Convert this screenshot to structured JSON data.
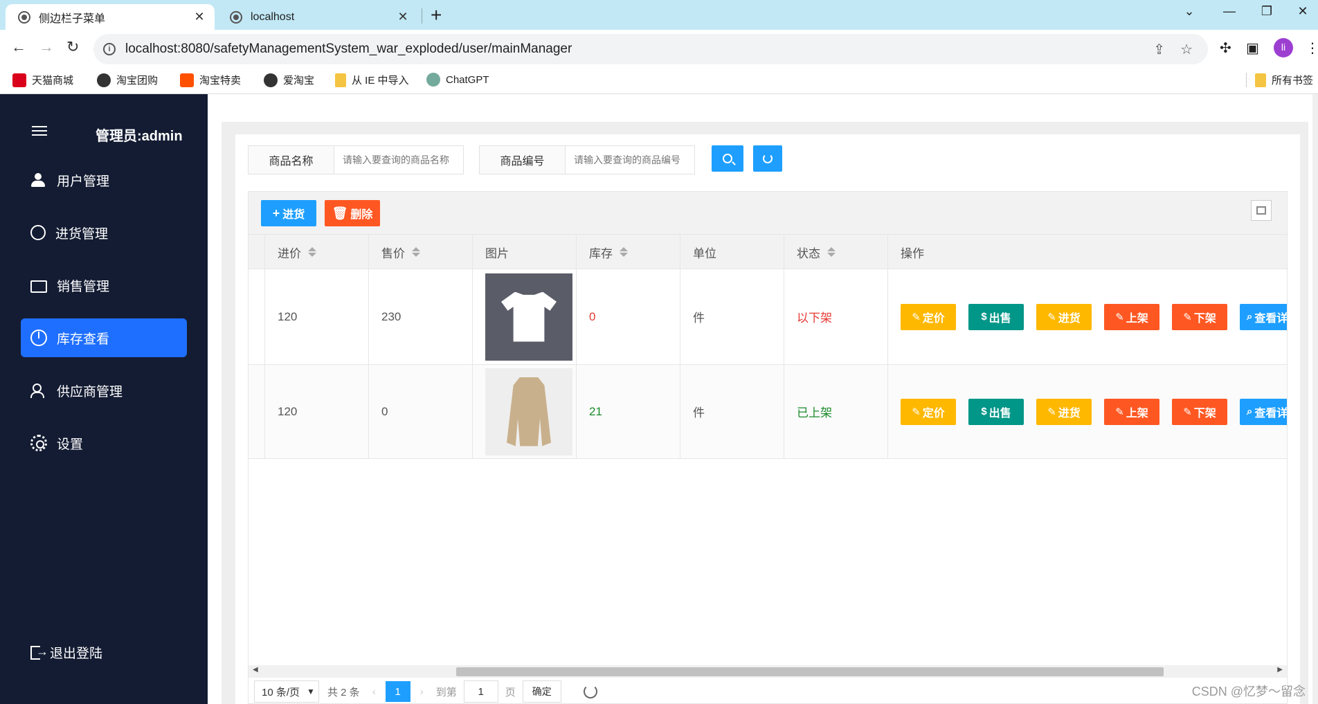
{
  "browser": {
    "tabs": [
      {
        "title": "侧边栏子菜单",
        "active": true
      },
      {
        "title": "localhost",
        "active": false
      }
    ],
    "url": "localhost:8080/safetyManagementSystem_war_exploded/user/mainManager",
    "profile_initial": "li",
    "bookmarks": [
      {
        "label": "天猫商城",
        "icon": "tmall-icon",
        "color": "#d9001b"
      },
      {
        "label": "淘宝团购",
        "icon": "globe-icon",
        "color": "#333333"
      },
      {
        "label": "淘宝特卖",
        "icon": "taobao-icon",
        "color": "#ff5000"
      },
      {
        "label": "爱淘宝",
        "icon": "globe-icon",
        "color": "#333333"
      },
      {
        "label": "从 IE 中导入",
        "icon": "folder-icon",
        "color": "#f4c542"
      },
      {
        "label": "ChatGPT",
        "icon": "chatgpt-icon",
        "color": "#74aa9c"
      }
    ],
    "all_bookmarks": "所有书签"
  },
  "sidebar": {
    "title": "管理员:admin",
    "items": [
      {
        "label": "用户管理",
        "icon": "users-icon",
        "active": false
      },
      {
        "label": "进货管理",
        "icon": "chat-icon",
        "active": false
      },
      {
        "label": "销售管理",
        "icon": "folder-icon",
        "active": false
      },
      {
        "label": "库存查看",
        "icon": "pie-chart-icon",
        "active": true
      },
      {
        "label": "供应商管理",
        "icon": "group-icon",
        "active": false
      },
      {
        "label": "设置",
        "icon": "gear-icon",
        "active": false
      }
    ],
    "logout": "退出登陆"
  },
  "search": {
    "name_label": "商品名称",
    "name_placeholder": "请输入要查询的商品名称",
    "code_label": "商品编号",
    "code_placeholder": "请输入要查询的商品编号"
  },
  "toolbar": {
    "stock_in": "进货",
    "delete": "删除"
  },
  "table": {
    "headers": [
      "进价",
      "售价",
      "图片",
      "库存",
      "单位",
      "状态",
      "操作"
    ],
    "rows": [
      {
        "cost": "120",
        "price": "230",
        "image": "white-tshirt",
        "stock": "0",
        "unit": "件",
        "status": "以下架"
      },
      {
        "cost": "120",
        "price": "0",
        "image": "beige-trench-coat",
        "stock": "21",
        "unit": "件",
        "status": "已上架"
      }
    ],
    "actions": {
      "price": "定价",
      "sell": "出售",
      "stock": "进货",
      "up": "上架",
      "down": "下架",
      "view": "查看详"
    }
  },
  "pager": {
    "page_size": "10 条/页",
    "total": "共 2 条",
    "current": "1",
    "goto_label": "到第",
    "goto_value": "1",
    "page_unit": "页",
    "confirm": "确定"
  },
  "colors": {
    "sidebar_bg": "#141c33",
    "active_menu": "#1e6fff",
    "primary": "#1e9fff",
    "warn": "#ffb800",
    "danger": "#ff5722",
    "teal": "#009688"
  },
  "watermark": "CSDN @忆梦～留念"
}
